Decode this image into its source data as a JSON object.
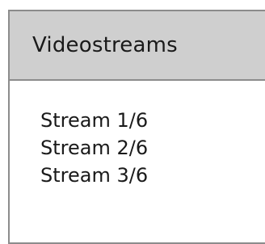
{
  "panel": {
    "title": "Videostreams",
    "streams": [
      {
        "label": "Stream 1/6"
      },
      {
        "label": "Stream 2/6"
      },
      {
        "label": "Stream 3/6"
      }
    ]
  },
  "colors": {
    "header_background": "#cfcfcf",
    "border": "#8c8c8c",
    "text": "#1a1a1a"
  }
}
